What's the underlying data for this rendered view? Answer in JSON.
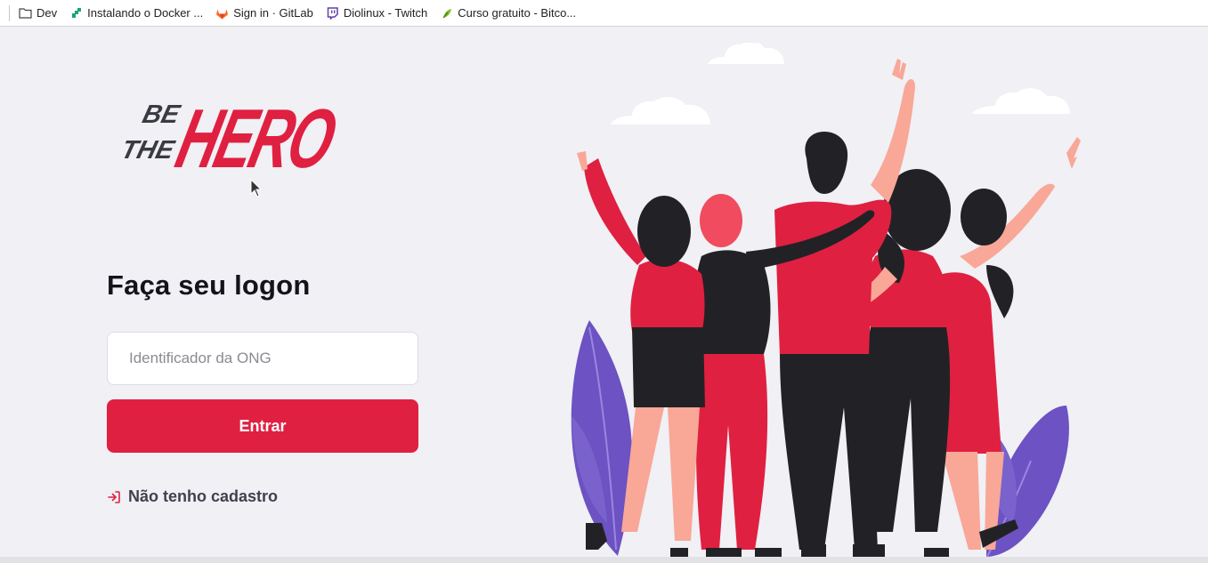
{
  "bookmarks": [
    {
      "label": "Dev",
      "icon": "folder-icon"
    },
    {
      "label": "Instalando o Docker ...",
      "icon": "docs-site-icon"
    },
    {
      "label": "Sign in · GitLab",
      "icon": "gitlab-icon"
    },
    {
      "label": "Diolinux - Twitch",
      "icon": "twitch-icon"
    },
    {
      "label": "Curso gratuito - Bitco...",
      "icon": "course-site-icon"
    }
  ],
  "logo": {
    "line1": "BE",
    "line2": "THE",
    "brand": "HERO"
  },
  "login": {
    "title": "Faça seu logon",
    "ong_id_placeholder": "Identificador da ONG",
    "ong_id_value": "",
    "submit_label": "Entrar",
    "register_link": "Não tenho cadastro"
  },
  "colors": {
    "accent": "#e02041",
    "background": "#f0f0f5",
    "title": "#13131a",
    "text": "#41414d",
    "illustration_dark": "#222226",
    "illustration_skin": "#f9a797",
    "illustration_leaf": "#6c52c2"
  }
}
